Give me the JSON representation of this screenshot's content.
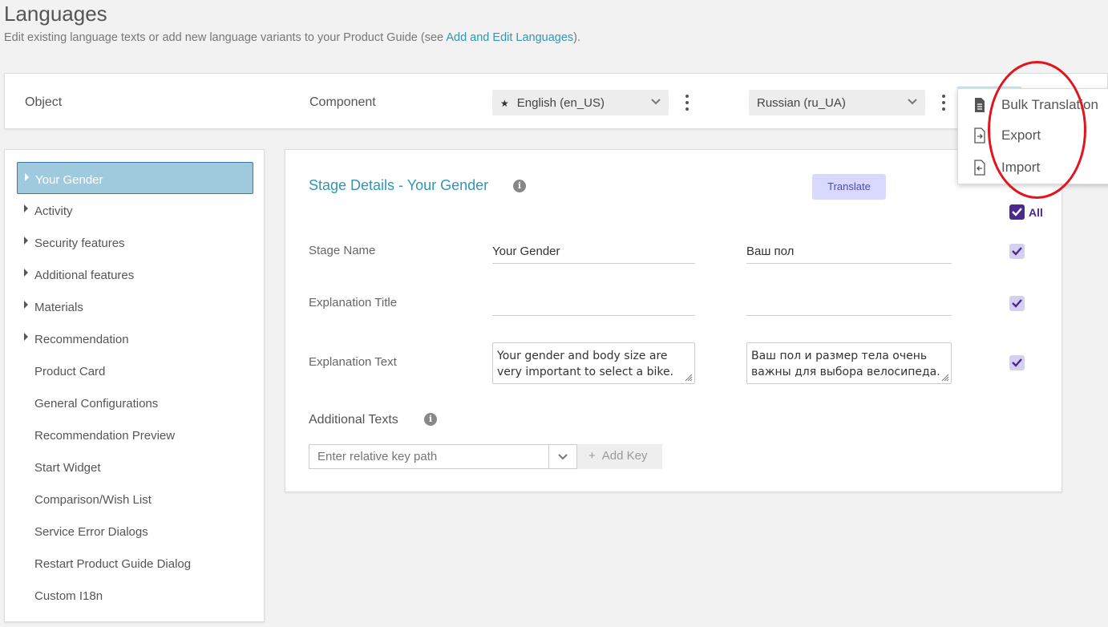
{
  "page": {
    "title": "Languages",
    "subtitle_prefix": "Edit existing language texts or add new language variants to your Product Guide (see ",
    "subtitle_link": "Add and Edit Languages",
    "subtitle_suffix": ")."
  },
  "topbar": {
    "object_label": "Object",
    "component_label": "Component",
    "source_language": "English (en_US)",
    "target_language": "Russian (ru_UA)"
  },
  "menu": {
    "items": [
      {
        "label": "Bulk Translation",
        "icon": "document-icon"
      },
      {
        "label": "Export",
        "icon": "export-icon"
      },
      {
        "label": "Import",
        "icon": "import-icon"
      }
    ]
  },
  "sidebar": {
    "items": [
      {
        "label": "Your Gender",
        "expandable": true,
        "active": true
      },
      {
        "label": "Activity",
        "expandable": true
      },
      {
        "label": "Security features",
        "expandable": true
      },
      {
        "label": "Additional features",
        "expandable": true
      },
      {
        "label": "Materials",
        "expandable": true
      },
      {
        "label": "Recommendation",
        "expandable": true
      },
      {
        "label": "Product Card",
        "expandable": false
      },
      {
        "label": "General Configurations",
        "expandable": false
      },
      {
        "label": "Recommendation Preview",
        "expandable": false
      },
      {
        "label": "Start Widget",
        "expandable": false
      },
      {
        "label": "Comparison/Wish List",
        "expandable": false
      },
      {
        "label": "Service Error Dialogs",
        "expandable": false
      },
      {
        "label": "Restart Product Guide Dialog",
        "expandable": false
      },
      {
        "label": "Custom I18n",
        "expandable": false
      }
    ]
  },
  "main": {
    "stage_title": "Stage Details - Your Gender",
    "translate_label": "Translate",
    "all_label": "All",
    "rows": [
      {
        "label": "Stage Name",
        "source": "Your Gender",
        "target": "Ваш пол"
      },
      {
        "label": "Explanation Title",
        "source": "",
        "target": ""
      },
      {
        "label": "Explanation Text",
        "source": "Your gender and body size are very important to select a bike.",
        "target": "Ваш пол и размер тела очень важны для выбора велосипеда."
      }
    ],
    "additional_title": "Additional Texts",
    "key_placeholder": "Enter relative key path",
    "add_key_label": "Add Key"
  },
  "colors": {
    "accent": "#2f97b5",
    "checkbox": "#4b2a8f",
    "highlight": "#e2141d"
  }
}
